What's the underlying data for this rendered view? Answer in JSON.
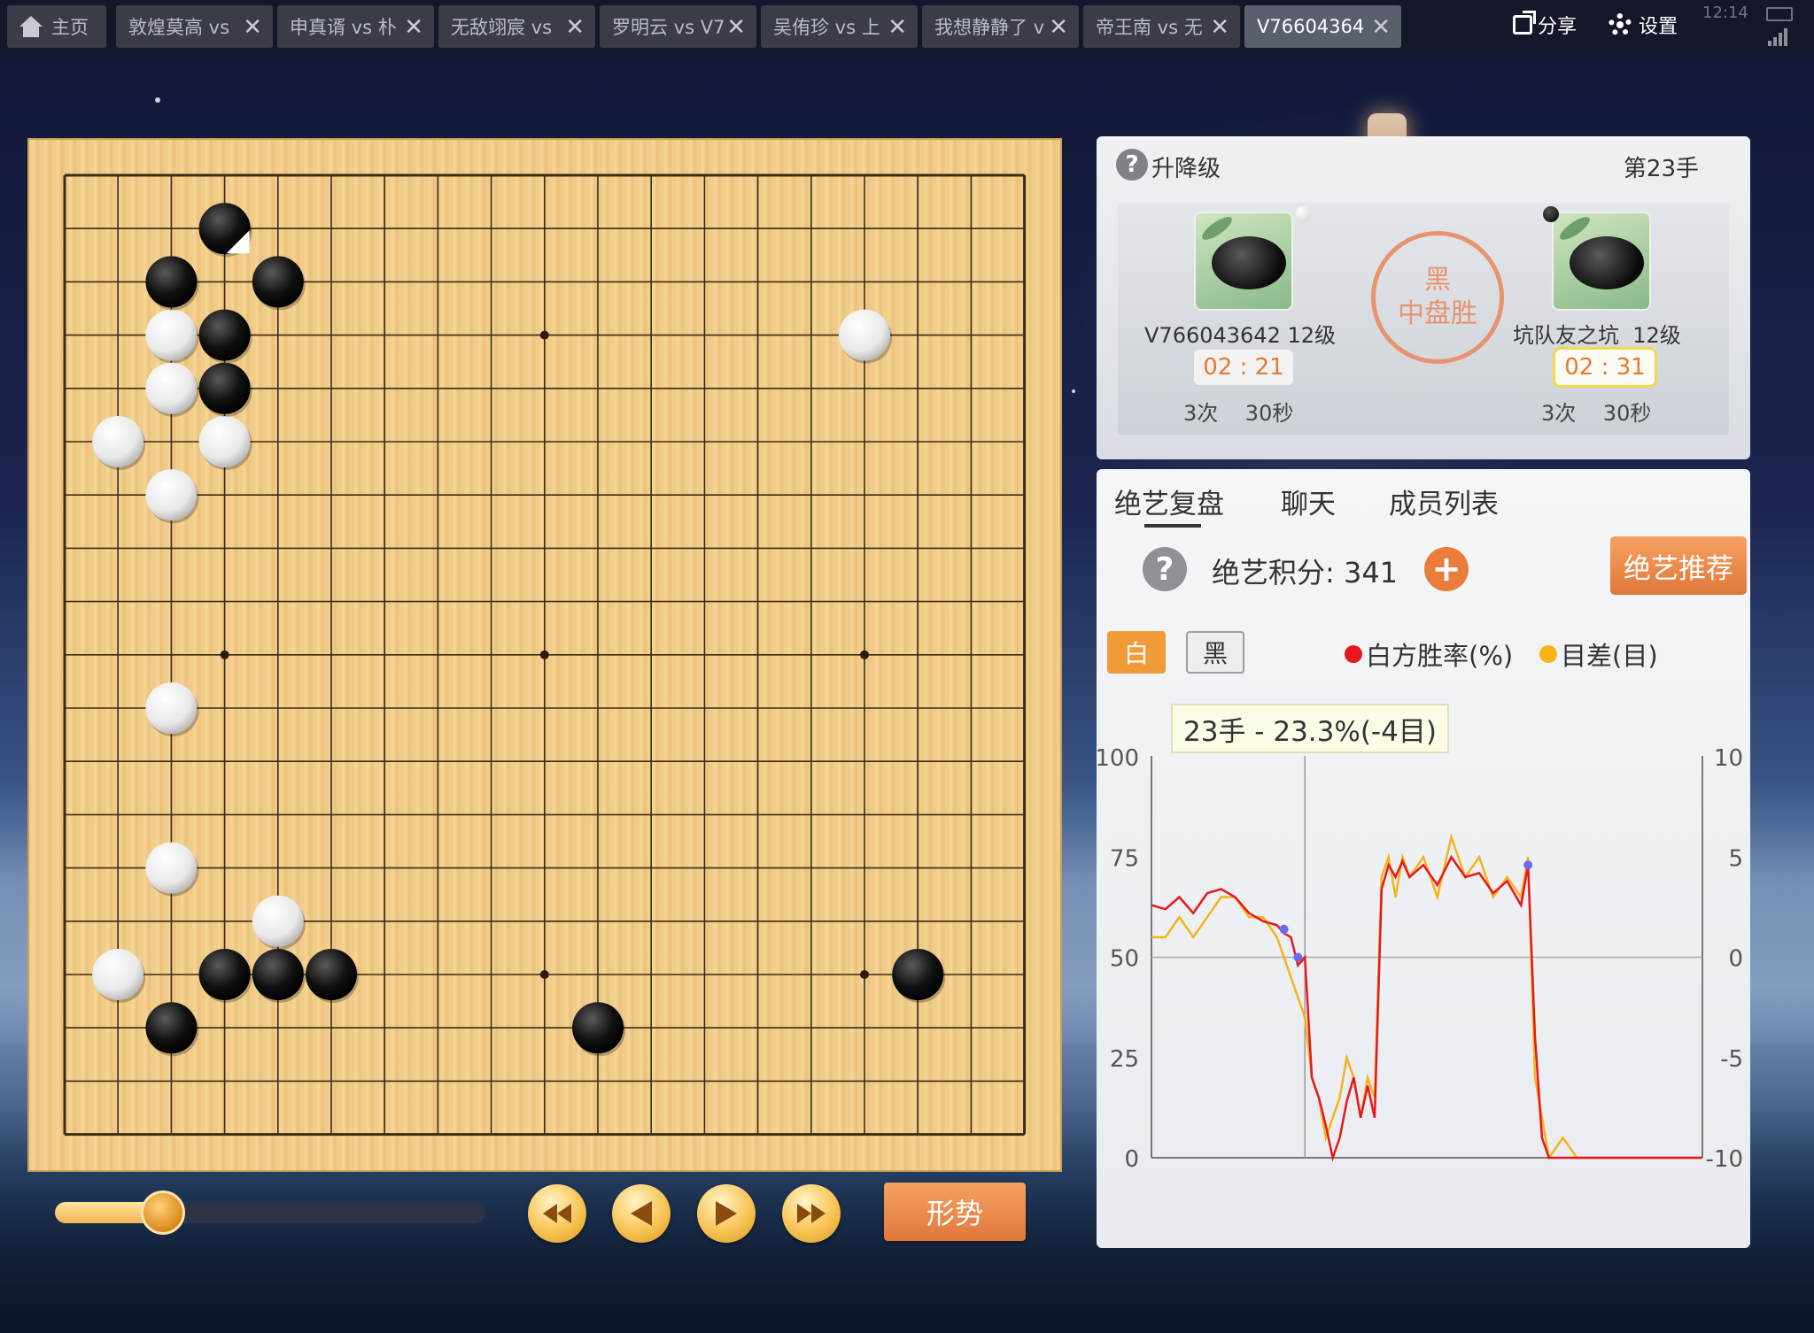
{
  "tabs": [
    {
      "label": "主页",
      "type": "home",
      "icon": "home-icon"
    },
    {
      "label": "敦煌莫高 vs",
      "close": "✕"
    },
    {
      "label": "申真谞 vs 朴",
      "close": "✕"
    },
    {
      "label": "无敌翊宸 vs",
      "close": "✕"
    },
    {
      "label": "罗明云 vs V7",
      "close": "✕"
    },
    {
      "label": "吴侑珍 vs 上",
      "close": "✕"
    },
    {
      "label": "我想静静了 v",
      "close": "✕"
    },
    {
      "label": "帝王南 vs 无",
      "close": "✕"
    },
    {
      "label": "V76604364",
      "close": "✕",
      "active": true
    }
  ],
  "top_actions": {
    "share": "分享",
    "settings": "设置",
    "clock": "12:14"
  },
  "board": {
    "size": 19,
    "black_stones": [
      [
        3,
        1
      ],
      [
        2,
        2
      ],
      [
        4,
        2
      ],
      [
        3,
        3
      ],
      [
        3,
        4
      ],
      [
        3,
        15
      ],
      [
        4,
        15
      ],
      [
        5,
        15
      ],
      [
        2,
        16
      ],
      [
        10,
        16
      ],
      [
        16,
        15
      ]
    ],
    "white_stones": [
      [
        2,
        3
      ],
      [
        2,
        4
      ],
      [
        1,
        5
      ],
      [
        3,
        5
      ],
      [
        2,
        6
      ],
      [
        15,
        3
      ],
      [
        2,
        10
      ],
      [
        2,
        13
      ],
      [
        4,
        14
      ],
      [
        1,
        15
      ]
    ],
    "last_move": [
      3,
      1
    ],
    "star_points": [
      [
        3,
        3
      ],
      [
        9,
        3
      ],
      [
        15,
        3
      ],
      [
        3,
        9
      ],
      [
        9,
        9
      ],
      [
        15,
        9
      ],
      [
        3,
        15
      ],
      [
        9,
        15
      ],
      [
        15,
        15
      ]
    ]
  },
  "playback": {
    "progress_fraction": 0.25,
    "shape_button": "形势"
  },
  "game_info": {
    "level_label": "升降级",
    "move_label": "第23手",
    "result_line1": "黑",
    "result_line2": "中盘胜",
    "left_player": {
      "name": "V766043642",
      "rank": "12级",
      "time": "02 : 21",
      "periods": "3次",
      "byoyomi": "30秒",
      "color": "white"
    },
    "right_player": {
      "name": "坑队友之坑",
      "rank": "12级",
      "time": "02 : 31",
      "periods": "3次",
      "byoyomi": "30秒",
      "color": "black"
    }
  },
  "analysis": {
    "tabs": [
      "绝艺复盘",
      "聊天",
      "成员列表"
    ],
    "score_label": "绝艺积分: 341",
    "plus": "+",
    "recommend_button": "绝艺推荐",
    "side_white": "白",
    "side_black": "黑",
    "legend_winrate": "白方胜率(%)",
    "legend_margin": "目差(目)",
    "tooltip": "23手 - 23.3%(-4目)",
    "colors": {
      "winrate": "#e8171b",
      "margin": "#f7b31a",
      "accent": "#e0773a"
    }
  },
  "chart_data": {
    "type": "line",
    "x_label": "",
    "y_left": {
      "ticks": [
        "100",
        "75",
        "50",
        "25",
        "0"
      ],
      "range": [
        0,
        100
      ]
    },
    "y_right": {
      "ticks": [
        "10",
        "5",
        "0",
        "-5",
        "-10"
      ],
      "range": [
        -10,
        10
      ]
    },
    "x_range": [
      1,
      80
    ],
    "marker_move": 23,
    "series": [
      {
        "name": "白方胜率(%)",
        "axis": "left",
        "x": [
          1,
          3,
          5,
          7,
          9,
          11,
          13,
          15,
          17,
          19,
          20,
          21,
          22,
          23,
          24,
          25,
          26,
          27,
          28,
          29,
          30,
          31,
          32,
          33,
          34,
          35,
          36,
          37,
          38,
          40,
          42,
          44,
          46,
          48,
          50,
          52,
          54,
          55,
          56,
          57,
          58,
          60,
          62,
          64,
          66,
          70,
          74,
          78,
          80
        ],
        "y": [
          63,
          62,
          65,
          61,
          66,
          67,
          65,
          61,
          59,
          58,
          56,
          55,
          48,
          50,
          20,
          15,
          8,
          0,
          5,
          14,
          20,
          10,
          18,
          10,
          67,
          73,
          70,
          74,
          70,
          73,
          68,
          75,
          70,
          71,
          66,
          69,
          63,
          73,
          30,
          5,
          0,
          0,
          0,
          0,
          0,
          0,
          0,
          0,
          0
        ]
      },
      {
        "name": "目差(目)",
        "axis": "right",
        "x": [
          1,
          3,
          5,
          7,
          9,
          11,
          13,
          15,
          17,
          19,
          20,
          21,
          22,
          23,
          24,
          25,
          26,
          27,
          28,
          29,
          30,
          31,
          32,
          33,
          34,
          35,
          36,
          37,
          38,
          40,
          42,
          44,
          46,
          48,
          50,
          52,
          54,
          55,
          56,
          57,
          58,
          60,
          62,
          64,
          66,
          70,
          74,
          78,
          80
        ],
        "y": [
          1,
          1,
          2,
          1,
          2,
          3,
          3,
          2,
          2,
          1,
          0,
          -1,
          -2,
          -3,
          -6,
          -7,
          -9,
          -8,
          -7,
          -5,
          -6,
          -8,
          -6,
          -7,
          4,
          5,
          3,
          5,
          4,
          5,
          3,
          6,
          4,
          5,
          3,
          4,
          3,
          5,
          -6,
          -8,
          -10,
          -9,
          -10,
          -10,
          -10,
          -10,
          -10,
          -10,
          -10
        ]
      }
    ],
    "highlight_points": [
      [
        20,
        57
      ],
      [
        22,
        50
      ],
      [
        55,
        73
      ]
    ],
    "grid": true
  }
}
